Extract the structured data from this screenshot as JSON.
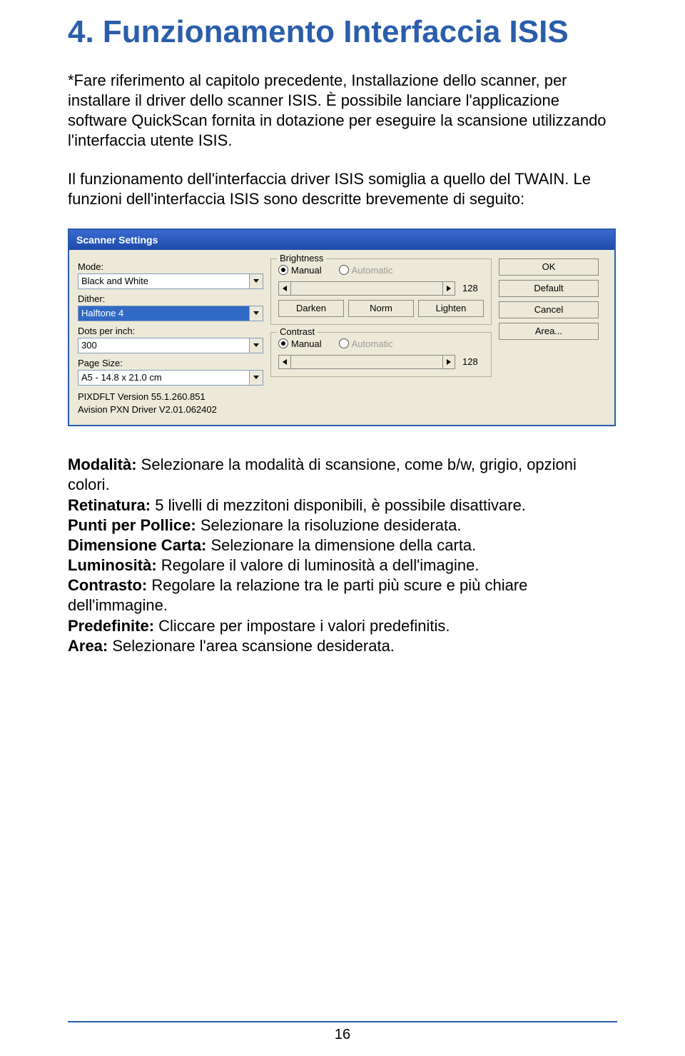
{
  "heading": "4. Funzionamento Interfaccia ISIS",
  "paragraphs": {
    "p1": "*Fare riferimento al capitolo precedente, Installazione dello scanner, per installare il driver dello scanner ISIS. È possibile lanciare l'applicazione software QuickScan fornita in dotazione per eseguire la scansione utilizzando l'interfaccia utente ISIS.",
    "p2": "Il funzionamento dell'interfaccia driver ISIS somiglia a quello del TWAIN. Le funzioni dell'interfaccia ISIS sono descritte brevemente di seguito:"
  },
  "dialog": {
    "title": "Scanner Settings",
    "labels": {
      "mode": "Mode:",
      "dither": "Dither:",
      "dpi": "Dots per inch:",
      "pagesize": "Page Size:"
    },
    "values": {
      "mode": "Black and White",
      "dither": "Halftone 4",
      "dpi": "300",
      "pagesize": "A5 - 14.8 x 21.0 cm"
    },
    "footer1": "PIXDFLT Version 55.1.260.851",
    "footer2": "Avision PXN Driver V2.01.062402",
    "brightness": {
      "title": "Brightness",
      "manual": "Manual",
      "automatic": "Automatic",
      "value": "128",
      "darken": "Darken",
      "norm": "Norm",
      "lighten": "Lighten"
    },
    "contrast": {
      "title": "Contrast",
      "manual": "Manual",
      "automatic": "Automatic",
      "value": "128"
    },
    "buttons": {
      "ok": "OK",
      "default": "Default",
      "cancel": "Cancel",
      "area": "Area..."
    }
  },
  "defs": {
    "modalita_term": "Modalità:",
    "modalita_text": " Selezionare la modalità di scansione, come b/w, grigio, opzioni colori.",
    "retin_term": "Retinatura:",
    "retin_text": " 5 livelli di mezzitoni disponibili, è possibile disattivare.",
    "ppp_term": "Punti per Pollice:",
    "ppp_text": " Selezionare la risoluzione desiderata.",
    "dim_term": "Dimensione Carta:",
    "dim_text": " Selezionare la dimensione della carta.",
    "lum_term": "Luminosità:",
    "lum_text": " Regolare il valore di luminosità a dell'imagine.",
    "contr_term": "Contrasto:",
    "contr_text": " Regolare la relazione tra le parti più scure e più chiare dell'immagine.",
    "pred_term": "Predefinite:",
    "pred_text": " Cliccare per impostare i valori predefinitis.",
    "area_term": "Area:",
    "area_text": " Selezionare l'area scansione desiderata."
  },
  "pageNumber": "16"
}
